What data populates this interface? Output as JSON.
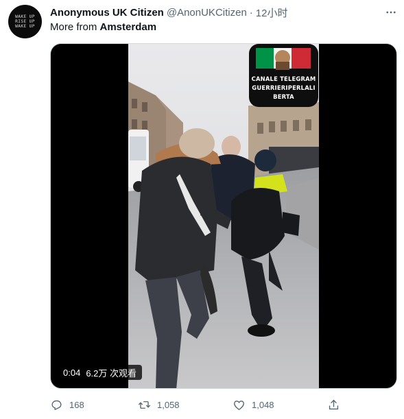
{
  "author": {
    "display_name": "Anonymous UK Citizen",
    "handle": "@AnonUKCitizen",
    "separator": "·",
    "timestamp": "12小时",
    "avatar_lines": [
      "WAKE UP",
      "RISE UP",
      "WAKE UP"
    ]
  },
  "context": {
    "prefix": "More from ",
    "location": "Amsterdam"
  },
  "video": {
    "duration": "0:04",
    "views": "6.2万 次观看",
    "watermark_lines": [
      "CANALE TELEGRAM",
      "GUERRIERIPERLALI",
      "BERTA"
    ]
  },
  "actions": {
    "reply_count": "168",
    "retweet_count": "1,058",
    "like_count": "1,048"
  },
  "icons": {
    "more": "more-dots-icon",
    "reply": "reply-bubble-icon",
    "retweet": "retweet-icon",
    "like": "heart-icon",
    "share": "share-icon"
  },
  "colors": {
    "text_primary": "#0f1419",
    "text_secondary": "#536471",
    "border": "#cfd9de",
    "media_bg": "#000000",
    "flag_green": "#009246",
    "flag_red": "#ce2b37"
  }
}
